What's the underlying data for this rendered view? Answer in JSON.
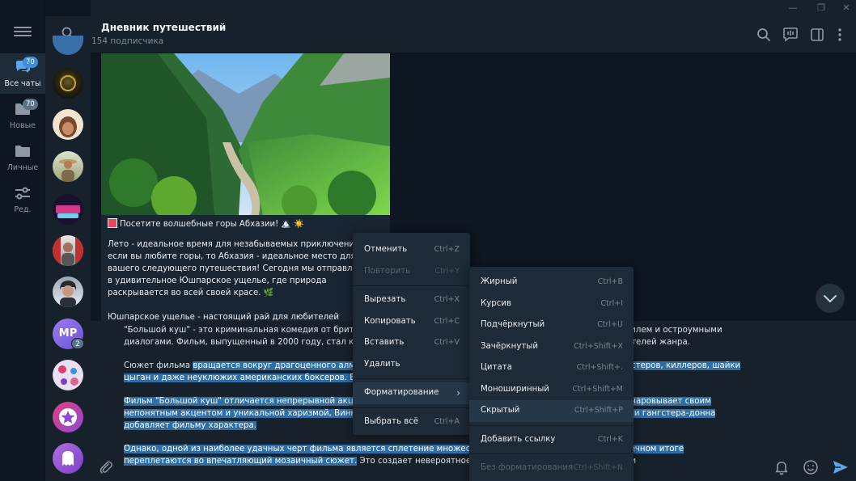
{
  "window": {
    "minimize": "—",
    "maximize": "❐",
    "close": "✕"
  },
  "folders": [
    {
      "label": "Все чаты",
      "badge": "70",
      "icon": "chat-bubbles-icon",
      "active": true
    },
    {
      "label": "Новые",
      "badge": "70",
      "icon": "folder-icon",
      "active": false
    },
    {
      "label": "Личные",
      "badge": "",
      "icon": "folder-icon",
      "active": false
    },
    {
      "label": "Ред.",
      "badge": "",
      "icon": "sliders-icon",
      "active": false
    }
  ],
  "chat_list": {
    "avatars": [
      {
        "name": "avatar-dark-emblem"
      },
      {
        "name": "avatar-cartoon"
      },
      {
        "name": "avatar-person-hat"
      },
      {
        "name": "avatar-cherry-logo"
      },
      {
        "name": "avatar-person-red"
      },
      {
        "name": "avatar-person-dark"
      },
      {
        "name": "avatar-mp",
        "initials": "МР",
        "badge": "2"
      },
      {
        "name": "avatar-pattern"
      },
      {
        "name": "avatar-star"
      },
      {
        "name": "avatar-ghost"
      }
    ]
  },
  "header": {
    "title": "Дневник путешествий",
    "subtitle": "154 подписчика"
  },
  "post": {
    "headline": "Посетите волшебные горы Абхазии! 🏔️ ☀️",
    "paragraph1": "Лето - идеальное время для незабываемых приключений, и если вы любите горы, то Абхазия - идеальное место для вашего следующего путешествия! Сегодня мы отправляемся в удивительное Юшпарское ущелье, где природа раскрывается во всей своей красе. 🌿",
    "paragraph2": "Юшпарское ущелье - настоящий рай для любителей активного отдыха"
  },
  "editor": {
    "p1": "\"Большой куш\" - это криминальная комедия от британского режиссера Гая Ричи, известного своим уникальным стилем и остроумными диалогами. Фильм, выпущенный в 2000 году, стал культовым и завоевал любовь миллионов зрителей и представителей жанра.",
    "p2_a": "Сюжет фильма ",
    "p2_sel": "вращается вокруг драгоценного алмаза, за которым охотятся различные персонажи, включая гангстеров, киллеров, шайки цыган и даже неуклюжих американских боксеров. Все они стремятся получить свою часть \"большого куша\".",
    "p3_sel": "Фильм \"Большой куш\" отличается непрерывной акцией и яркими персонажами. Брэд Питт в роли боксера Микки очаровывает своим непонятным акцентом и уникальной харизмой, Винни Джонс в роли британского гангстера, а Деннис Фарина в роли гангстера-донна добавляет фильму характера.",
    "p4_sel": "Однако, одной из наиболее удачных черт фильма является сплетение множества сюжетных линий, которые в конечном итоге переплетаются во впечатляющий мозаичный сюжет.",
    "p4_b": " Это создает невероятное напряжение, события развиваются и"
  },
  "context_menu": {
    "items": [
      {
        "label": "Отменить",
        "shortcut": "Ctrl+Z",
        "disabled": false
      },
      {
        "label": "Повторить",
        "shortcut": "Ctrl+Y",
        "disabled": true
      },
      {
        "sep": true
      },
      {
        "label": "Вырезать",
        "shortcut": "Ctrl+X",
        "disabled": false
      },
      {
        "label": "Копировать",
        "shortcut": "Ctrl+C",
        "disabled": false
      },
      {
        "label": "Вставить",
        "shortcut": "Ctrl+V",
        "disabled": false
      },
      {
        "label": "Удалить",
        "shortcut": "",
        "disabled": false
      },
      {
        "sep": true
      },
      {
        "label": "Форматирование",
        "shortcut": "",
        "submenu": true,
        "highlighted": true
      },
      {
        "sep": true
      },
      {
        "label": "Выбрать всё",
        "shortcut": "Ctrl+A",
        "disabled": false
      }
    ]
  },
  "format_menu": {
    "items": [
      {
        "label": "Жирный",
        "shortcut": "Ctrl+B"
      },
      {
        "label": "Курсив",
        "shortcut": "Ctrl+I"
      },
      {
        "label": "Подчёркнутый",
        "shortcut": "Ctrl+U"
      },
      {
        "label": "Зачёркнутый",
        "shortcut": "Ctrl+Shift+X"
      },
      {
        "label": "Цитата",
        "shortcut": "Ctrl+Shift+."
      },
      {
        "label": "Моноширинный",
        "shortcut": "Ctrl+Shift+M"
      },
      {
        "label": "Скрытый",
        "shortcut": "Ctrl+Shift+P",
        "highlighted": true
      },
      {
        "sep": true
      },
      {
        "label": "Добавить ссылку",
        "shortcut": "Ctrl+K"
      },
      {
        "sep": true
      },
      {
        "label": "Без форматирования",
        "shortcut": "Ctrl+Shift+N",
        "disabled": true
      }
    ]
  },
  "colors": {
    "bg": "#0e1621",
    "panel": "#17212b",
    "accent": "#3d8fdc",
    "selection": "#2f6ea5",
    "menu": "#1d2a37"
  }
}
